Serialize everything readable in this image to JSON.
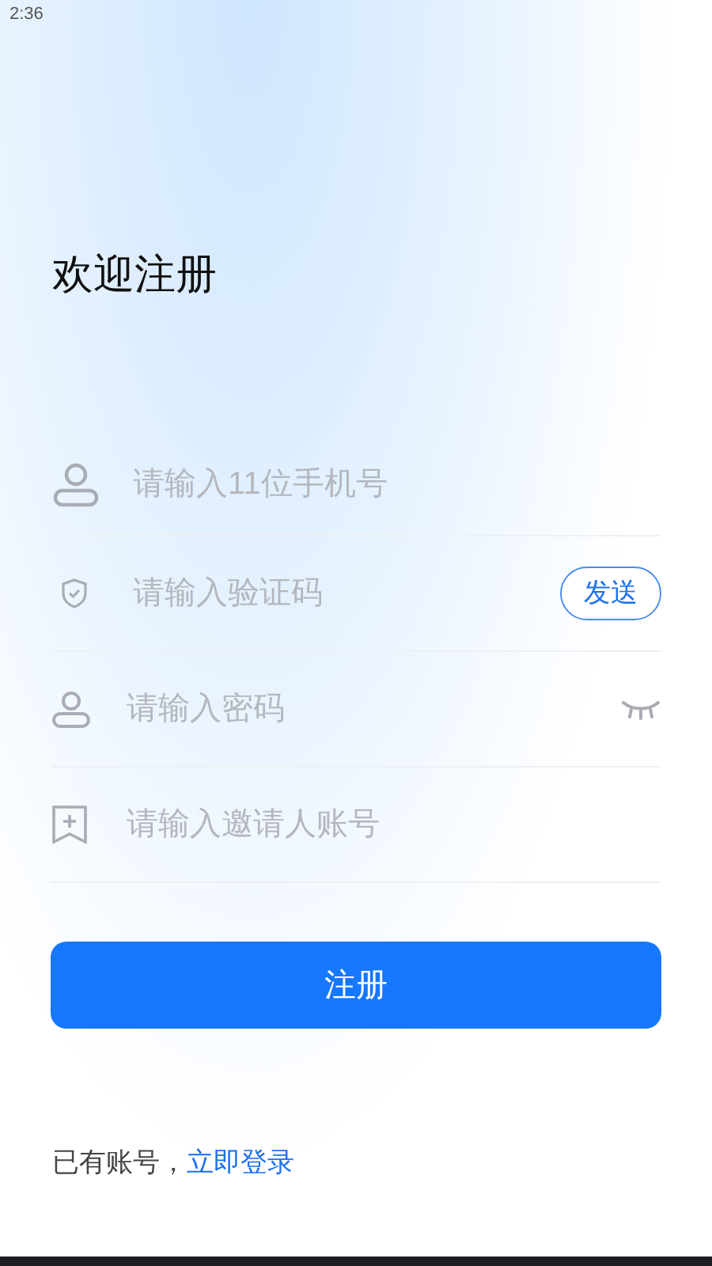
{
  "status_bar": {
    "time": "2:36"
  },
  "title": "欢迎注册",
  "fields": [
    {
      "kind": "phone",
      "placeholder": "请输入11位手机号"
    },
    {
      "kind": "code",
      "placeholder": "请输入验证码",
      "button": "发送"
    },
    {
      "kind": "password",
      "placeholder": "请输入密码"
    },
    {
      "kind": "invite",
      "placeholder": "请输入邀请人账号"
    }
  ],
  "submit": "注册",
  "login": {
    "text": "已有账号，",
    "link": "立即登录"
  }
}
